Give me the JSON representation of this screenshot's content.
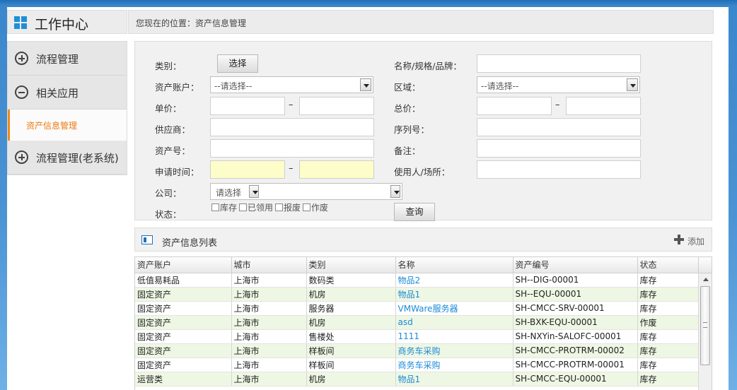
{
  "app": {
    "title": "工作中心"
  },
  "breadcrumb": {
    "text": "您现在的位置：资产信息管理"
  },
  "sidebar": {
    "items": [
      {
        "label": "流程管理"
      },
      {
        "label": "相关应用"
      },
      {
        "label": "资产信息管理"
      },
      {
        "label": "流程管理(老系统)"
      }
    ]
  },
  "search": {
    "category_label": "类别：",
    "select_button": "选择",
    "name_label": "名称/规格/品牌：",
    "account_label": "资产账户：",
    "account_value": "--请选择--",
    "region_label": "区域：",
    "region_value": "--请选择--",
    "unit_price_label": "单价：",
    "total_price_label": "总价：",
    "dash": "–",
    "supplier_label": "供应商：",
    "serial_label": "序列号：",
    "asset_no_label": "资产号：",
    "remark_label": "备注：",
    "apply_time_label": "申请时间：",
    "user_label": "使用人/场所：",
    "company_label": "公司：",
    "company_value": "请选择",
    "status_label": "状态：",
    "status_options": [
      "库存",
      "已领用",
      "报废",
      "作废"
    ],
    "query_button": "查询"
  },
  "list": {
    "title": "资产信息列表",
    "add_label": "添加",
    "columns": [
      "资产账户",
      "城市",
      "类别",
      "名称",
      "资产编号",
      "状态"
    ],
    "rows": [
      [
        "低值易耗品",
        "上海市",
        "数码类",
        "物品2",
        "SH--DIG-00001",
        "库存"
      ],
      [
        "固定资产",
        "上海市",
        "机房",
        "物品1",
        "SH--EQU-00001",
        "库存"
      ],
      [
        "固定资产",
        "上海市",
        "服务器",
        "VMWare服务器",
        "SH-CMCC-SRV-00001",
        "库存"
      ],
      [
        "固定资产",
        "上海市",
        "机房",
        "asd",
        "SH-BXK-EQU-00001",
        "作废"
      ],
      [
        "固定资产",
        "上海市",
        "售楼处",
        "1111",
        "SH-NXYin-SALOFC-00001",
        "库存"
      ],
      [
        "固定资产",
        "上海市",
        "样板间",
        "商务车采购",
        "SH-CMCC-PROTRM-00002",
        "库存"
      ],
      [
        "固定资产",
        "上海市",
        "样板间",
        "商务车采购",
        "SH-CMCC-PROTRM-00001",
        "库存"
      ],
      [
        "运营类",
        "上海市",
        "机房",
        "物品1",
        "SH-CMCC-EQU-00001",
        "库存"
      ]
    ]
  }
}
